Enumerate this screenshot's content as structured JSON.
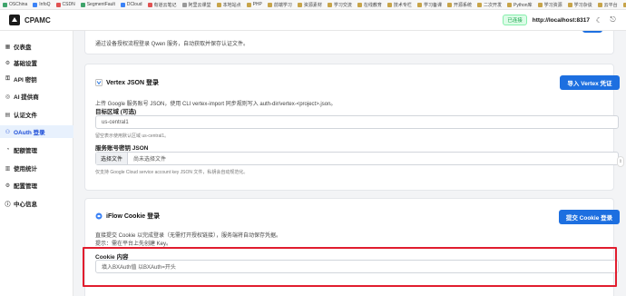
{
  "bookmarks": [
    {
      "label": "OSChina",
      "color": "green"
    },
    {
      "label": "InfoQ",
      "color": "blue"
    },
    {
      "label": "CSDN",
      "color": "red"
    },
    {
      "label": "SegmentFault",
      "color": "green"
    },
    {
      "label": "DCloud",
      "color": "blue"
    },
    {
      "label": "有道云笔记",
      "color": "red"
    },
    {
      "label": "阿里云课堂",
      "color": "gray"
    },
    {
      "label": "本地站点",
      "color": ""
    },
    {
      "label": "PHP",
      "color": ""
    },
    {
      "label": "前端学习",
      "color": ""
    },
    {
      "label": "资源素材",
      "color": ""
    },
    {
      "label": "学习交流",
      "color": ""
    },
    {
      "label": "在线教育",
      "color": ""
    },
    {
      "label": "技术专栏",
      "color": ""
    },
    {
      "label": "学习备课",
      "color": ""
    },
    {
      "label": "开源系统",
      "color": ""
    },
    {
      "label": "二次开发",
      "color": ""
    },
    {
      "label": "Python库",
      "color": ""
    },
    {
      "label": "学习资源",
      "color": ""
    },
    {
      "label": "学习杂谈",
      "color": ""
    },
    {
      "label": "云平台",
      "color": ""
    },
    {
      "label": "Developers",
      "color": ""
    },
    {
      "label": "优质网址",
      "color": ""
    }
  ],
  "header": {
    "title": "CPAMC",
    "status": "已连接",
    "host": "http://localhost:8317"
  },
  "sidebar": {
    "items": [
      {
        "label": "仪表盘",
        "icon": "▦"
      },
      {
        "label": "基础设置",
        "icon": "⚙"
      },
      {
        "label": "API 密钥",
        "icon": "⚿"
      },
      {
        "label": "AI 提供商",
        "icon": "◎"
      },
      {
        "label": "认证文件",
        "icon": "▤"
      },
      {
        "label": "OAuth 登录",
        "icon": "⚇"
      },
      {
        "label": "配额管理",
        "icon": "◔"
      },
      {
        "label": "使用统计",
        "icon": "▥"
      },
      {
        "label": "配置管理",
        "icon": "⚙"
      },
      {
        "label": "中心信息",
        "icon": "ⓘ"
      }
    ],
    "active_index": 5
  },
  "qwen": {
    "desc": "通过设备授权流程登录 Qwen 服务，自动获取并保存认证文件。"
  },
  "vertex": {
    "title": "Vertex JSON 登录",
    "import_button": "导入 Vertex 凭证",
    "desc": "上传 Google 服务账号 JSON，使用 CLI vertex-import 同步规则写入 auth-dir/vertex-<project>.json。",
    "region_label": "目标区域 (可选)",
    "region_placeholder": "us-central1",
    "region_hint": "留空表示使用默认区域 us-central1。",
    "key_label": "服务账号密钥 JSON",
    "file_button": "选择文件",
    "file_placeholder": "尚未选择文件",
    "file_hint": "仅支持 Google Cloud service account key JSON 文件，私钥会自动规范化。"
  },
  "iflow": {
    "title": "iFlow Cookie 登录",
    "submit_button": "提交 Cookie 登录",
    "desc": "直接提交 Cookie 以完成登录（无需打开授权链接），服务端将自动保存凭据。",
    "tip": "提示：需在平台上先创建 Key。",
    "cookie_label": "Cookie 内容",
    "cookie_placeholder": "填入BXAuth值 以BXAuth=开头"
  }
}
